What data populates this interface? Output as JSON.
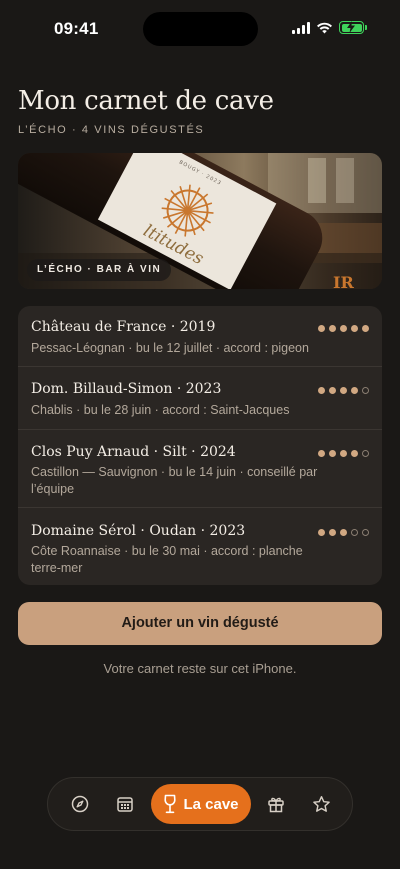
{
  "status_bar": {
    "time": "09:41"
  },
  "header": {
    "title": "Mon carnet de cave",
    "subtitle": "L’ÉCHO · 4 VINS DÉGUSTÉS"
  },
  "hero": {
    "badge": "L’ÉCHO · BAR À VIN",
    "label_top": "BOUGY · 2023",
    "label_word": "ltitudes",
    "label_word2": "IR"
  },
  "wines": [
    {
      "name": "Château de France · 2019",
      "meta": "Pessac-Léognan · bu le 12 juillet · accord : pigeon",
      "rating": 5,
      "max": 5
    },
    {
      "name": "Dom. Billaud-Simon · 2023",
      "meta": "Chablis · bu le 28 juin · accord : Saint-Jacques",
      "rating": 4,
      "max": 5
    },
    {
      "name": "Clos Puy Arnaud · Silt · 2024",
      "meta": "Castillon — Sauvignon · bu le 14 juin · conseillé par l’équipe",
      "rating": 4,
      "max": 5
    },
    {
      "name": "Domaine Sérol · Oudan · 2023",
      "meta": "Côte Roannaise · bu le 30 mai · accord : planche terre-mer",
      "rating": 3,
      "max": 5
    }
  ],
  "actions": {
    "add_label": "Ajouter un vin dégusté"
  },
  "footnote": "Votre carnet reste sur cet iPhone.",
  "tab_bar": {
    "tabs": [
      {
        "icon": "compass-icon"
      },
      {
        "icon": "calendar-icon"
      },
      {
        "icon": "wine-glass-icon",
        "label": "La cave",
        "active": true
      },
      {
        "icon": "gift-icon"
      },
      {
        "icon": "star-icon"
      }
    ]
  },
  "colors": {
    "background": "#1a1816",
    "card": "#2a2623",
    "accent": "#e5701c",
    "button": "#c9a07e",
    "rating_on": "#d1a882",
    "battery": "#3fd35b"
  }
}
